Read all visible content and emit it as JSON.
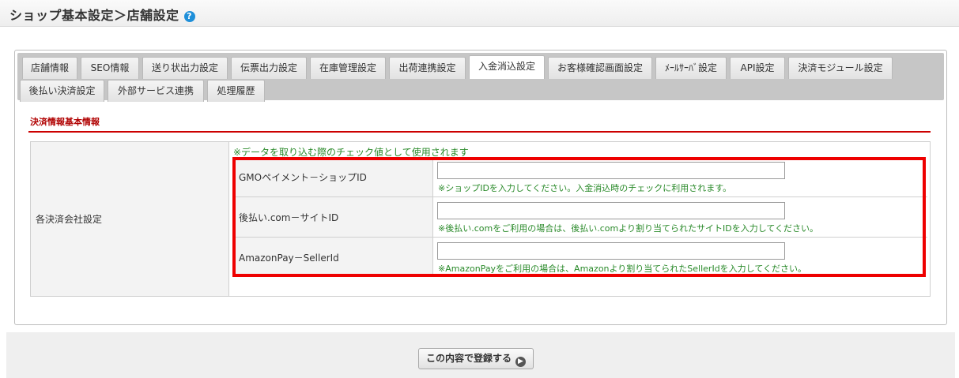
{
  "header": {
    "title": "ショップ基本設定＞店舗設定",
    "help_icon": "?"
  },
  "tabs": [
    {
      "label": "店舗情報"
    },
    {
      "label": "SEO情報"
    },
    {
      "label": "送り状出力設定"
    },
    {
      "label": "伝票出力設定"
    },
    {
      "label": "在庫管理設定"
    },
    {
      "label": "出荷連携設定"
    },
    {
      "label": "入金消込設定",
      "active": true
    },
    {
      "label": "お客様確認画面設定"
    },
    {
      "label": "ﾒｰﾙｻｰﾊﾞ設定"
    },
    {
      "label": "API設定"
    },
    {
      "label": "決済モジュール設定"
    },
    {
      "label": "後払い決済設定"
    },
    {
      "label": "外部サービス連携"
    },
    {
      "label": "処理履歴"
    }
  ],
  "section": {
    "title": "決済情報基本情報"
  },
  "table": {
    "group_label": "各決済会社設定",
    "top_note": "※データを取り込む際のチェック値として使用されます",
    "rows": [
      {
        "label": "GMOペイメント－ショップID",
        "value": "",
        "note": "※ショップIDを入力してください。入金消込時のチェックに利用されます。"
      },
      {
        "label": "後払い.com－サイトID",
        "value": "",
        "note": "※後払い.comをご利用の場合は、後払い.comより割り当てられたサイトIDを入力してください。"
      },
      {
        "label": "AmazonPay－SellerId",
        "value": "",
        "note": "※AmazonPayをご利用の場合は、Amazonより割り当てられたSellerIdを入力してください。"
      }
    ]
  },
  "footer": {
    "submit_label": "この内容で登録する",
    "submit_icon": "arrow-right"
  },
  "colors": {
    "accent_red": "#cc0000",
    "note_green": "#2a8a2a",
    "help_blue": "#1e8fd9"
  }
}
